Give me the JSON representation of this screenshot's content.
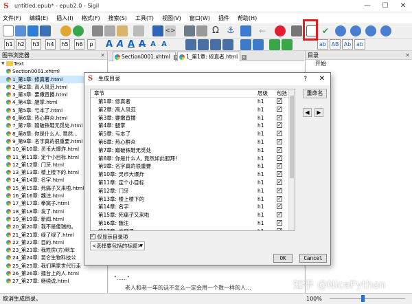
{
  "window": {
    "title": "untitled.epub* - epub2.0 - Sigil",
    "app_glyph": "S",
    "minimize": "—",
    "maximize": "☐",
    "close": "✕"
  },
  "menu": [
    "文件(F)",
    "编辑(E)",
    "插入(I)",
    "格式(F)",
    "搜索(S)",
    "工具(T)",
    "视图(V)",
    "窗口(W)",
    "插件",
    "帮助(H)"
  ],
  "heading_buttons": [
    "h1",
    "h2",
    "h3",
    "h4",
    "h5",
    "h6",
    "p"
  ],
  "style_buttons": [
    "ab",
    "AB",
    "Ab",
    "ab"
  ],
  "big_a_glyph": "A",
  "left_panel": {
    "title": "图书浏览器",
    "folder": "Text",
    "files": [
      "Section0001.xhtml",
      "1_第1章: 修真者.html",
      "2_第2章: 高人风范.html",
      "3_第3章: 要嫩直播.html",
      "4_第4章: 腿掌.html",
      "5_第5章: 亏本了.html",
      "6_第6章: 热心群众.html",
      "7_第7章: 蹭破铁鞋无觅处.html",
      "8_第8章: 你是什么人, 竟然...",
      "9_第9章: 名字真的很重要.html",
      "10_第10章: 灵币大爆炸.html",
      "11_第11章: 定个小目标.html",
      "12_第12章: 门牙.html",
      "13_第13章: 楼上楼下的.html",
      "14_第14章: 名字.html",
      "15_第15章: 死痛子又来啦.html",
      "16_第16章: 魏注.html",
      "17_第17章: 拳窝子.html",
      "18_第18章: 发了.html",
      "19_第19章: 新闻.html",
      "20_第20章: 我不是傻瑞的。",
      "21_第21章: 绿了绿了.html",
      "22_第22章: 目的.html",
      "23_第23章: 我姓房(方)到车",
      "24_第24章: 昆仑生物科技公",
      "25_第25章: 我们黑家世代行走",
      "26_第26章: 擂台上的人.html",
      "27_第27章: 继续说.html"
    ],
    "selected_index": 1
  },
  "editor": {
    "tabs": [
      {
        "label": "Section0001.xhtml",
        "close": "✕"
      },
      {
        "label": "1_第1章: 修真者.html",
        "close": "✕"
      }
    ],
    "body_fragment_top": "\"......\"",
    "body_fragment": "老人和老一年的话不怎么一定会用一个数一样的人..."
  },
  "right_panel": {
    "title": "目录",
    "items": [
      "开始"
    ]
  },
  "status": {
    "text": "取消生成目录。",
    "zoom": "100%"
  },
  "dialog": {
    "title": "生成目录",
    "help": "?",
    "close": "✕",
    "columns": [
      "章节",
      "层级",
      "包括"
    ],
    "rows": [
      {
        "title": "第1章: 修真者",
        "level": "h1"
      },
      {
        "title": "第2章: 高人风范",
        "level": "h1"
      },
      {
        "title": "第3章: 要嫩直播",
        "level": "h1"
      },
      {
        "title": "第4章: 腿掌",
        "level": "h1"
      },
      {
        "title": "第5章: 亏本了",
        "level": "h1"
      },
      {
        "title": "第6章: 热心群众",
        "level": "h1"
      },
      {
        "title": "第7章: 蹭破铁鞋无觅处",
        "level": "h1"
      },
      {
        "title": "第8章: 你是什么人, 竟然如此胆拜!",
        "level": "h1"
      },
      {
        "title": "第9章: 名字真的很重要",
        "level": "h1"
      },
      {
        "title": "第10章: 灵币大爆炸",
        "level": "h1"
      },
      {
        "title": "第11章: 定个小目标",
        "level": "h1"
      },
      {
        "title": "第12章: 门牙",
        "level": "h1"
      },
      {
        "title": "第13章: 楼上楼下的",
        "level": "h1"
      },
      {
        "title": "第14章: 名字",
        "level": "h1"
      },
      {
        "title": "第15章: 死痛子又来啦",
        "level": "h1"
      },
      {
        "title": "第16章: 魏注",
        "level": "h1"
      },
      {
        "title": "第17章: 拳窝子",
        "level": "h1"
      }
    ],
    "rename_button": "重命名",
    "left_arrow": "◀",
    "right_arrow": "▶",
    "show_only_included_label": "仅显示目录项",
    "select_heading_placeholder": "<选择要包括的标题>",
    "ok": "OK",
    "cancel": "Cancel"
  },
  "watermark": "知乎 @NicePython"
}
